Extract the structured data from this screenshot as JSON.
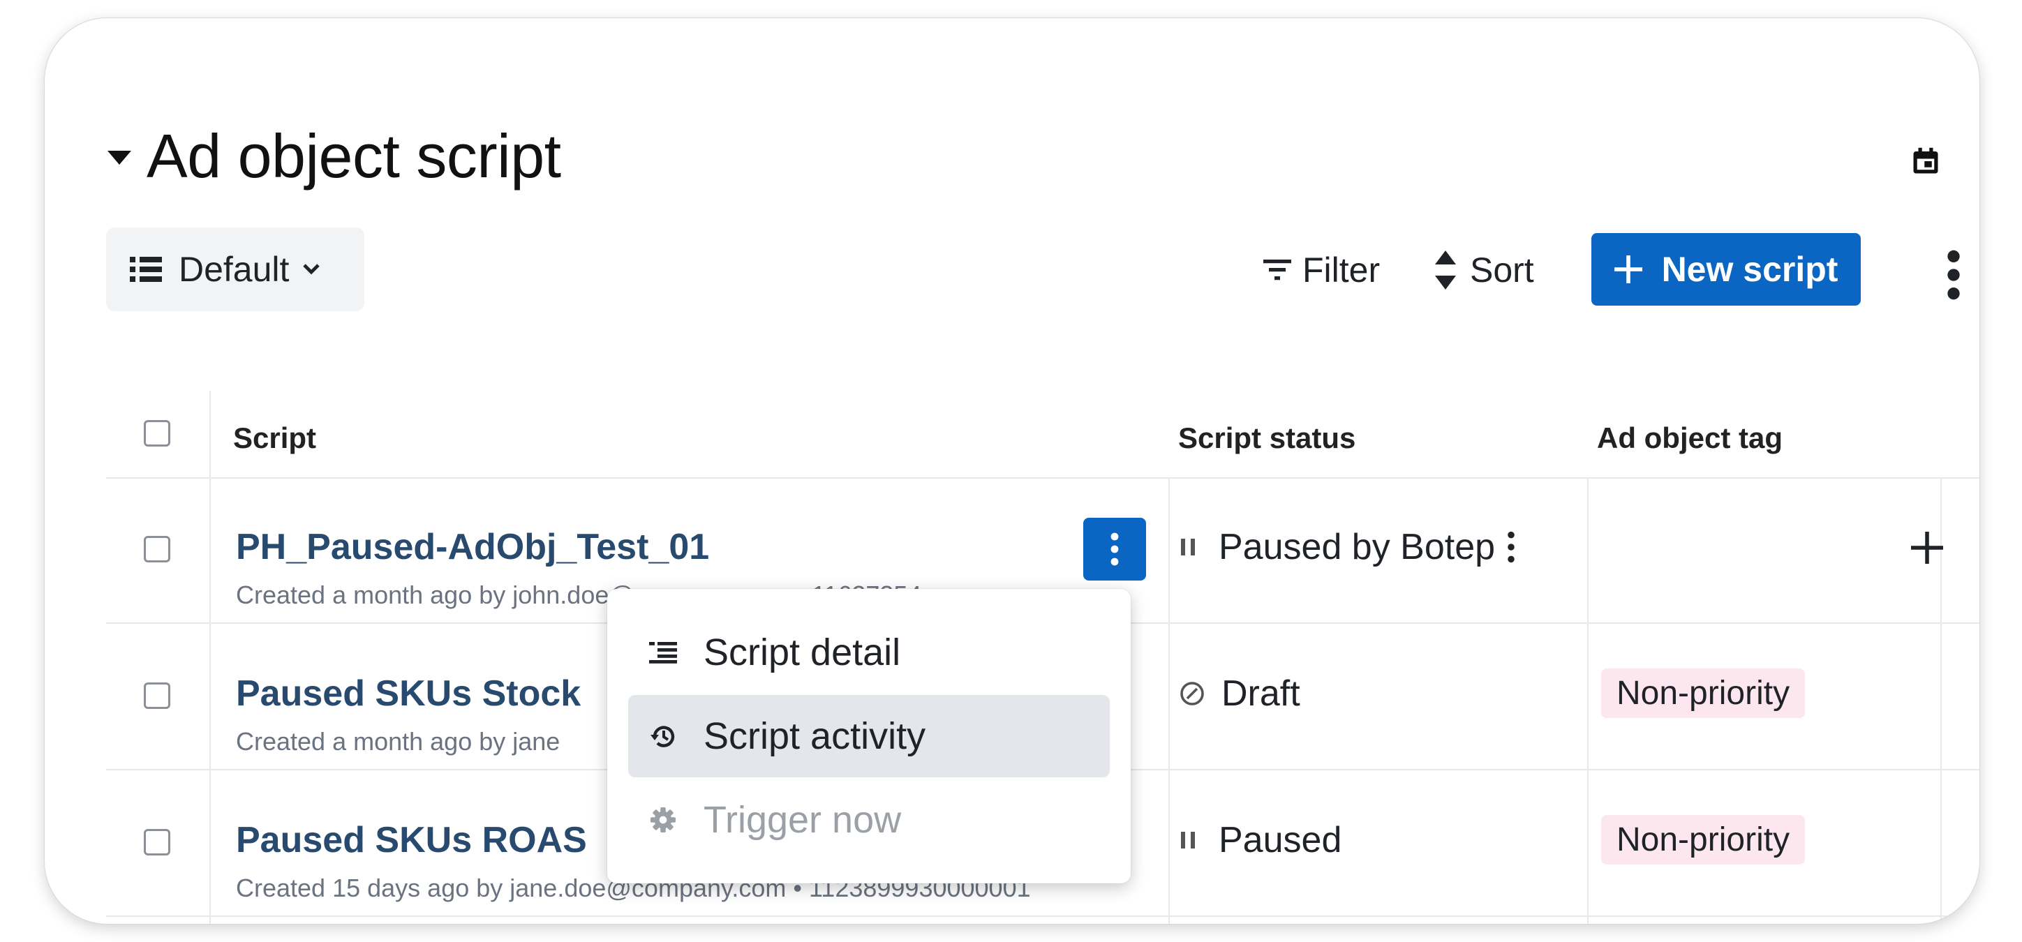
{
  "section": {
    "title": "Ad object script"
  },
  "toolbar": {
    "view_label": "Default",
    "filter_label": "Filter",
    "sort_label": "Sort",
    "new_label": "New script"
  },
  "table": {
    "columns": [
      "Script",
      "Script status",
      "Ad object tag"
    ],
    "rows": [
      {
        "name": "PH_Paused-AdObj_Test_01",
        "meta": "Created a month ago by john.doe@company.com • 11627354",
        "status": "Paused by Botep",
        "status_icon": "pause-icon",
        "tag": ""
      },
      {
        "name": "Paused SKUs Stock",
        "meta": "Created a month ago by jane",
        "status": "Draft",
        "status_icon": "draft-icon",
        "tag": "Non-priority"
      },
      {
        "name": "Paused SKUs ROAS",
        "meta": "Created 15 days ago by jane.doe@company.com • 1123899930000001",
        "status": "Paused",
        "status_icon": "pause-icon",
        "tag": "Non-priority"
      }
    ]
  },
  "menu": {
    "items": [
      {
        "label": "Script detail",
        "icon": "detail-list-icon",
        "state": "normal"
      },
      {
        "label": "Script activity",
        "icon": "history-icon",
        "state": "hover"
      },
      {
        "label": "Trigger now",
        "icon": "gear-icon",
        "state": "disabled"
      }
    ]
  },
  "colors": {
    "primary": "#0a66c2",
    "link": "#284a6e",
    "tag_bg": "#fde7ee",
    "menu_hover": "#e3e6ea"
  }
}
